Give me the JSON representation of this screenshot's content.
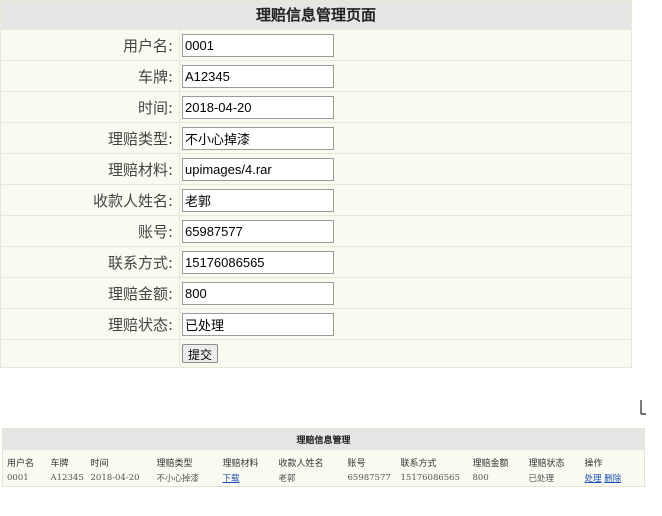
{
  "form": {
    "title": "理赔信息管理页面",
    "fields": [
      {
        "label": "用户名:",
        "value": "0001"
      },
      {
        "label": "车牌:",
        "value": "A12345"
      },
      {
        "label": "时间:",
        "value": "2018-04-20"
      },
      {
        "label": "理赔类型:",
        "value": "不小心掉漆"
      },
      {
        "label": "理赔材料:",
        "value": "upimages/4.rar"
      },
      {
        "label": "收款人姓名:",
        "value": "老郭"
      },
      {
        "label": "账号:",
        "value": "65987577"
      },
      {
        "label": "联系方式:",
        "value": "15176086565"
      },
      {
        "label": "理赔金额:",
        "value": "800"
      },
      {
        "label": "理赔状态:",
        "value": "已处理"
      }
    ],
    "submit_label": "提交"
  },
  "list": {
    "title": "理赔信息管理",
    "headers": [
      "用户名",
      "车牌",
      "时间",
      "理赔类型",
      "理赔材料",
      "收款人姓名",
      "账号",
      "联系方式",
      "理赔金额",
      "理赔状态",
      "操作"
    ],
    "rows": [
      {
        "user": "0001",
        "plate": "A12345",
        "date": "2018-04-20",
        "type": "不小心掉漆",
        "material": "下载",
        "payee": "老郭",
        "account": "65987577",
        "phone": "15176086565",
        "amount": "800",
        "status": "已处理",
        "action_process": "处理",
        "action_delete": "删除"
      }
    ]
  },
  "colors": {
    "header_bg": "#e5e5e5",
    "row_bg": "#fafaf0",
    "link": "#1a4fb8"
  }
}
